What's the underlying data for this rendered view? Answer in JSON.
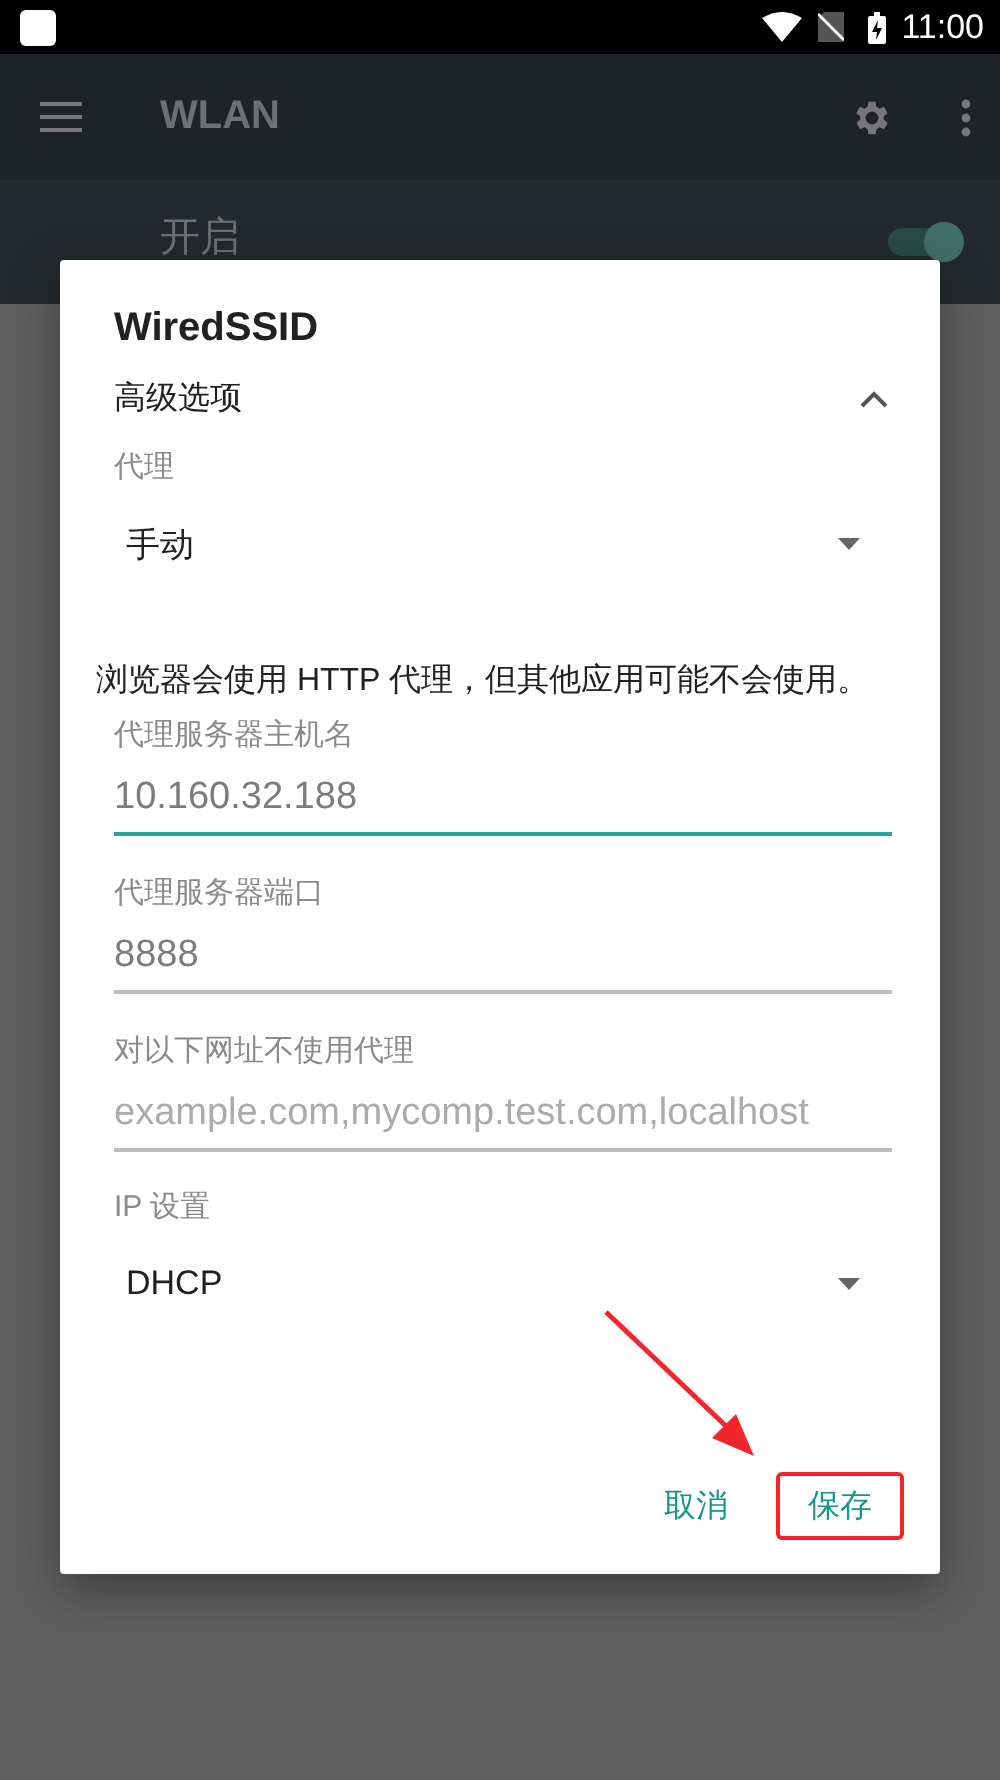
{
  "status_bar": {
    "time": "11:00"
  },
  "toolbar": {
    "title": "WLAN"
  },
  "wifi_switch": {
    "label": "开启",
    "on": true
  },
  "dialog": {
    "title": "WiredSSID",
    "advanced": {
      "label": "高级选项",
      "expanded": true
    },
    "proxy": {
      "label": "代理",
      "value": "手动"
    },
    "note": "浏览器会使用 HTTP 代理，但其他应用可能不会使用。",
    "fields": [
      {
        "label": "代理服务器主机名",
        "value": "10.160.32.188",
        "focused": true
      },
      {
        "label": "代理服务器端口",
        "value": "8888",
        "focused": false
      },
      {
        "label": "对以下网址不使用代理",
        "placeholder": "example.com,mycomp.test.com,localhost",
        "focused": false
      }
    ],
    "ip_settings": {
      "label": "IP 设置",
      "value": "DHCP"
    },
    "buttons": [
      {
        "label": "取消",
        "highlighted": false
      },
      {
        "label": "保存",
        "highlighted": true
      }
    ]
  }
}
